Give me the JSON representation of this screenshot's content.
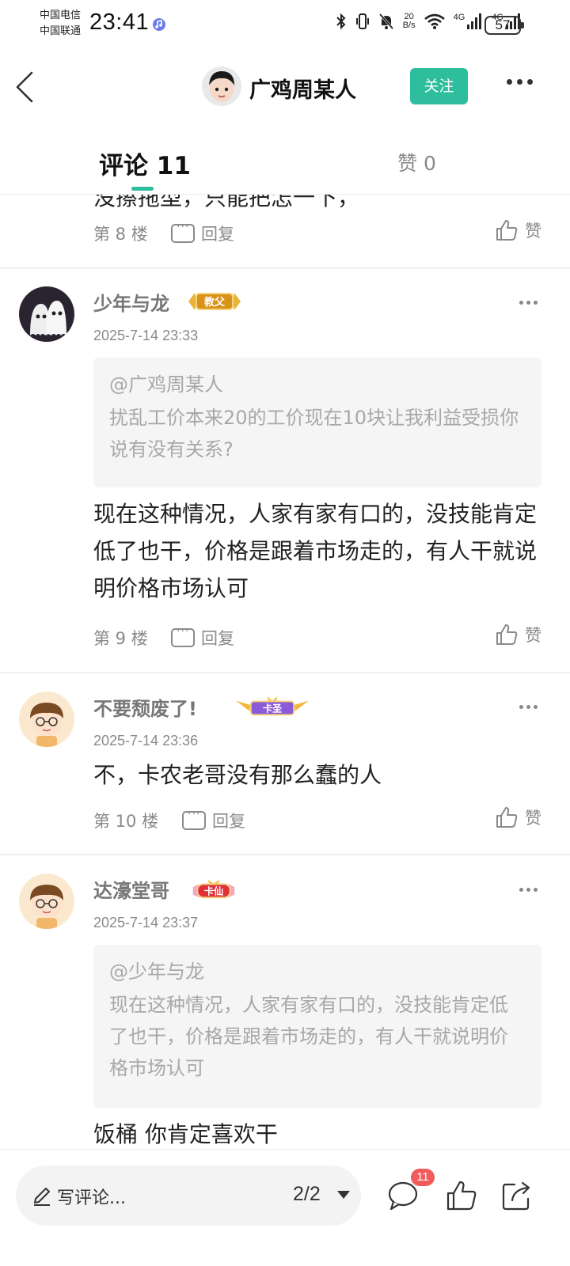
{
  "status_bar": {
    "carrier_1": "中国电信",
    "carrier_2": "中国联通",
    "time": "23:41",
    "net_speed_value": "20",
    "net_speed_unit": "B/s",
    "signal_1": "4G",
    "signal_2": "4G",
    "battery": "57"
  },
  "header": {
    "author_name": "广鸡周某人",
    "follow_label": "关注"
  },
  "tabs": {
    "comments_label": "评论 11",
    "likes_label": "赞 0"
  },
  "comments": [
    {
      "body_cut": "没擦拖型，只能把怎一下，",
      "floor": "第 8 楼",
      "reply_label": "回复",
      "like_label": "赞"
    },
    {
      "user": "少年与龙",
      "badge": "教父",
      "time": "2025-7-14 23:33",
      "quote_user": "@广鸡周某人",
      "quote_text": "扰乱工价本来20的工价现在10块让我利益受损你说有没有关系?",
      "body": "现在这种情况，人家有家有口的，没技能肯定低了也干，价格是跟着市场走的，有人干就说明价格市场认可",
      "floor": "第 9 楼",
      "reply_label": "回复",
      "like_label": "赞"
    },
    {
      "user": "不要颓废了!",
      "badge": "卡圣",
      "time": "2025-7-14 23:36",
      "body": "不，卡农老哥没有那么蠢的人",
      "floor": "第 10 楼",
      "reply_label": "回复",
      "like_label": "赞"
    },
    {
      "user": "达濠堂哥",
      "badge": "卡仙",
      "time": "2025-7-14 23:37",
      "quote_user": "@少年与龙",
      "quote_text": "现在这种情况，人家有家有口的，没技能肯定低了也干，价格是跟着市场走的，有人干就说明价格市场认可",
      "body": "饭桶 你肯定喜欢干"
    }
  ],
  "bottom_bar": {
    "write_placeholder": "写评论...",
    "page_indicator": "2/2",
    "comment_count": "11"
  },
  "colors": {
    "accent": "#2ebd9d",
    "badge_red": "#f25b5b"
  }
}
